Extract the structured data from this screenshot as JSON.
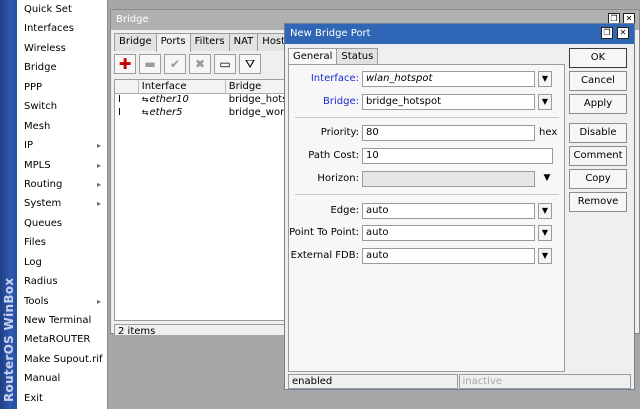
{
  "brand": {
    "text": "RouterOS WinBox"
  },
  "menu": {
    "items": [
      {
        "label": "Quick Set",
        "submenu": false
      },
      {
        "label": "Interfaces",
        "submenu": false
      },
      {
        "label": "Wireless",
        "submenu": false
      },
      {
        "label": "Bridge",
        "submenu": false
      },
      {
        "label": "PPP",
        "submenu": false
      },
      {
        "label": "Switch",
        "submenu": false
      },
      {
        "label": "Mesh",
        "submenu": false
      },
      {
        "label": "IP",
        "submenu": true
      },
      {
        "label": "MPLS",
        "submenu": true
      },
      {
        "label": "Routing",
        "submenu": true
      },
      {
        "label": "System",
        "submenu": true
      },
      {
        "label": "Queues",
        "submenu": false
      },
      {
        "label": "Files",
        "submenu": false
      },
      {
        "label": "Log",
        "submenu": false
      },
      {
        "label": "Radius",
        "submenu": false
      },
      {
        "label": "Tools",
        "submenu": true
      },
      {
        "label": "New Terminal",
        "submenu": false
      },
      {
        "label": "MetaROUTER",
        "submenu": false
      },
      {
        "label": "Make Supout.rif",
        "submenu": false
      },
      {
        "label": "Manual",
        "submenu": false
      },
      {
        "label": "Exit",
        "submenu": false
      }
    ],
    "submenu_arrow": "▸"
  },
  "bridge_window": {
    "title": "Bridge",
    "tabs": [
      "Bridge",
      "Ports",
      "Filters",
      "NAT",
      "Hosts"
    ],
    "active_tab": "Ports",
    "toolbar": {
      "add": "✚",
      "remove": "▬",
      "enable": "✔",
      "disable": "✖",
      "comment": "▭",
      "filter": "⛛"
    },
    "columns": {
      "flag": "",
      "interface": "Interface",
      "bridge": "Bridge"
    },
    "rows": [
      {
        "flag": "I",
        "interface": "ether10",
        "bridge": "bridge_hotspot"
      },
      {
        "flag": "I",
        "interface": "ether5",
        "bridge": "bridge_work"
      }
    ],
    "status": "2 items",
    "window_buttons": {
      "restore": "❐",
      "close": "✕"
    }
  },
  "dialog": {
    "title": "New Bridge Port",
    "tabs": [
      "General",
      "Status"
    ],
    "active_tab": "General",
    "fields": {
      "interface": {
        "label": "Interface:",
        "value": "wlan_hotspot"
      },
      "bridge": {
        "label": "Bridge:",
        "value": "bridge_hotspot"
      },
      "priority": {
        "label": "Priority:",
        "value": "80",
        "unit": "hex"
      },
      "path_cost": {
        "label": "Path Cost:",
        "value": "10"
      },
      "horizon": {
        "label": "Horizon:",
        "value": ""
      },
      "edge": {
        "label": "Edge:",
        "value": "auto"
      },
      "point_to_point": {
        "label": "Point To Point:",
        "value": "auto"
      },
      "external_fdb": {
        "label": "External FDB:",
        "value": "auto"
      }
    },
    "dropdown_glyph": "▼",
    "buttons": {
      "ok": "OK",
      "cancel": "Cancel",
      "apply": "Apply",
      "disable": "Disable",
      "comment": "Comment",
      "copy": "Copy",
      "remove": "Remove"
    },
    "status": {
      "left": "enabled",
      "right": "inactive"
    },
    "window_buttons": {
      "restore": "❐",
      "close": "✕"
    }
  },
  "colors": {
    "title_active": "#2f66b5",
    "title_inactive": "#b0b0b0",
    "label_blue": "#1a2bd0",
    "add_red": "#c90000"
  }
}
